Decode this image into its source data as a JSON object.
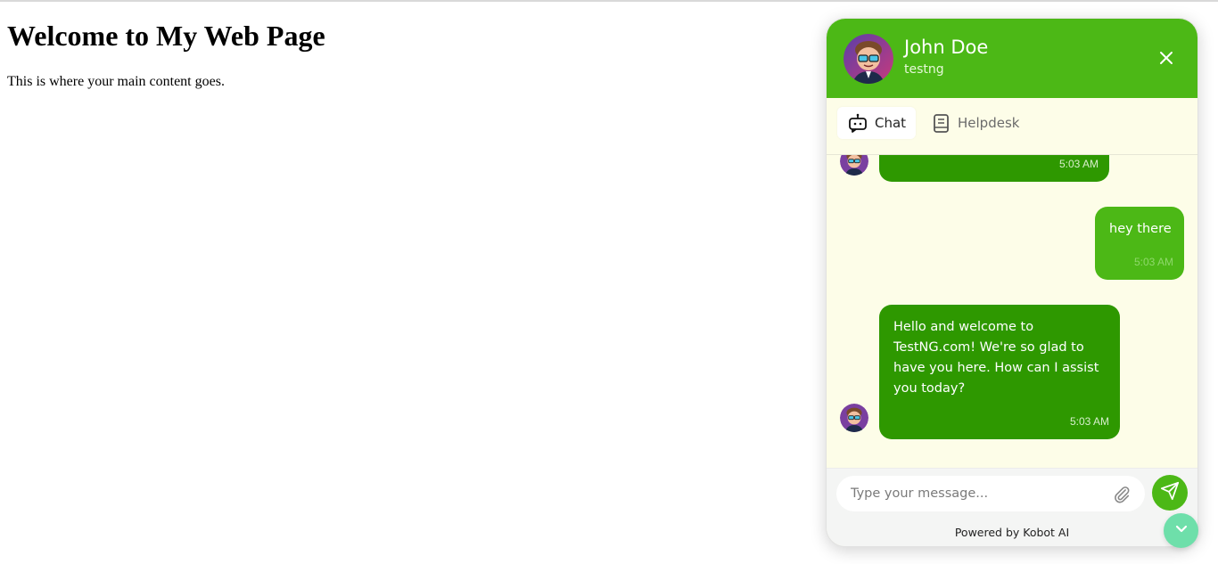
{
  "page": {
    "title": "Welcome to My Web Page",
    "body_text": "This is where your main content goes."
  },
  "chat_widget": {
    "header": {
      "name": "John Doe",
      "subtitle": "testng",
      "close_icon": "close-icon",
      "avatar_icon": "avatar-icon",
      "background_color": "#4cb816"
    },
    "tabs": [
      {
        "label": "Chat",
        "icon": "bot-icon",
        "active": true
      },
      {
        "label": "Helpdesk",
        "icon": "book-icon",
        "active": false
      }
    ],
    "messages": [
      {
        "sender": "bot",
        "text": "",
        "time": "5:03 AM",
        "partial": true
      },
      {
        "sender": "user",
        "text": "hey there",
        "time": "5:03 AM"
      },
      {
        "sender": "bot",
        "text": "Hello and welcome to TestNG.com! We're so glad to have you here. How can I assist you today?",
        "time": "5:03 AM"
      }
    ],
    "input": {
      "placeholder": "Type your message...",
      "value": "",
      "attach_icon": "paperclip-icon",
      "send_icon": "send-icon"
    },
    "footer": "Powered by Kobot AI",
    "scroll_button_icon": "chevron-down-icon",
    "colors": {
      "bot_bubble": "#2e9800",
      "user_bubble": "#4cb816",
      "chat_background": "#fdfde8",
      "scroll_button": "#6edfaa"
    }
  }
}
